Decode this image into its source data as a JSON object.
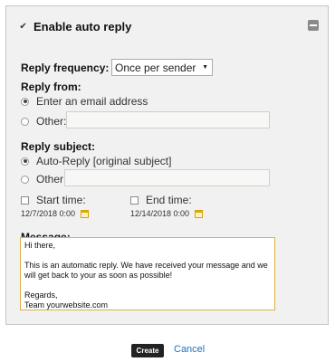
{
  "header": {
    "title": "Enable auto reply",
    "enabled": true
  },
  "frequency": {
    "label": "Reply frequency:",
    "selected": "Once per sender"
  },
  "reply_from": {
    "label": "Reply from:",
    "option_email": "Enter an email address",
    "option_other": "Other:",
    "other_value": ""
  },
  "reply_subject": {
    "label": "Reply subject:",
    "option_auto": "Auto-Reply [original subject]",
    "option_other": "Other:",
    "other_value": ""
  },
  "start_time": {
    "label": "Start time:",
    "date": "12/7/2018 0:00",
    "checked": false
  },
  "end_time": {
    "label": "End time:",
    "date": "12/14/2018 0:00",
    "checked": false
  },
  "message": {
    "label": "Message:",
    "text": "Hi there,\n\nThis is an automatic reply. We have received your message and we will get back to your as soon as possible!\n\nRegards,\nTeam yourwebsite.com"
  },
  "actions": {
    "create_label": "Create",
    "cancel_label": "Cancel"
  },
  "colors": {
    "accent_link": "#1a73c9",
    "message_border": "#e0b040",
    "button_bg": "#222222"
  }
}
